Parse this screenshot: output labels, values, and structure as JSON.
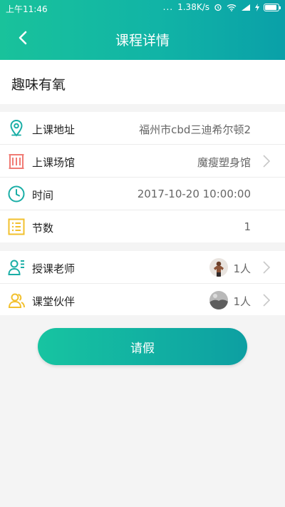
{
  "status_bar": {
    "time": "上午11:46",
    "dots": "...",
    "speed": "1.38K/s",
    "battery_level": 0.9
  },
  "header": {
    "title": "课程详情",
    "back_icon": "chevron-left-icon"
  },
  "course": {
    "name": "趣味有氧"
  },
  "details": [
    {
      "icon": "location-pin-icon",
      "label": "上课地址",
      "value": "福州市cbd三迪希尔顿2",
      "color": "#1aaea6"
    },
    {
      "icon": "building-icon",
      "label": "上课场馆",
      "value": "魔瘦塑身馆",
      "color": "#f07b74"
    },
    {
      "icon": "clock-icon",
      "label": "时间",
      "value": "2017-10-20 10:00:00",
      "color": "#1aaea6"
    },
    {
      "icon": "list-icon",
      "label": "节数",
      "value": "1",
      "color": "#f2c02e"
    }
  ],
  "people": [
    {
      "icon": "teacher-icon",
      "label": "授课老师",
      "count": "1人",
      "color": "#1aaea6"
    },
    {
      "icon": "partners-icon",
      "label": "课堂伙伴",
      "count": "1人",
      "color": "#f2c02e"
    }
  ],
  "leave_button": {
    "label": "请假"
  }
}
